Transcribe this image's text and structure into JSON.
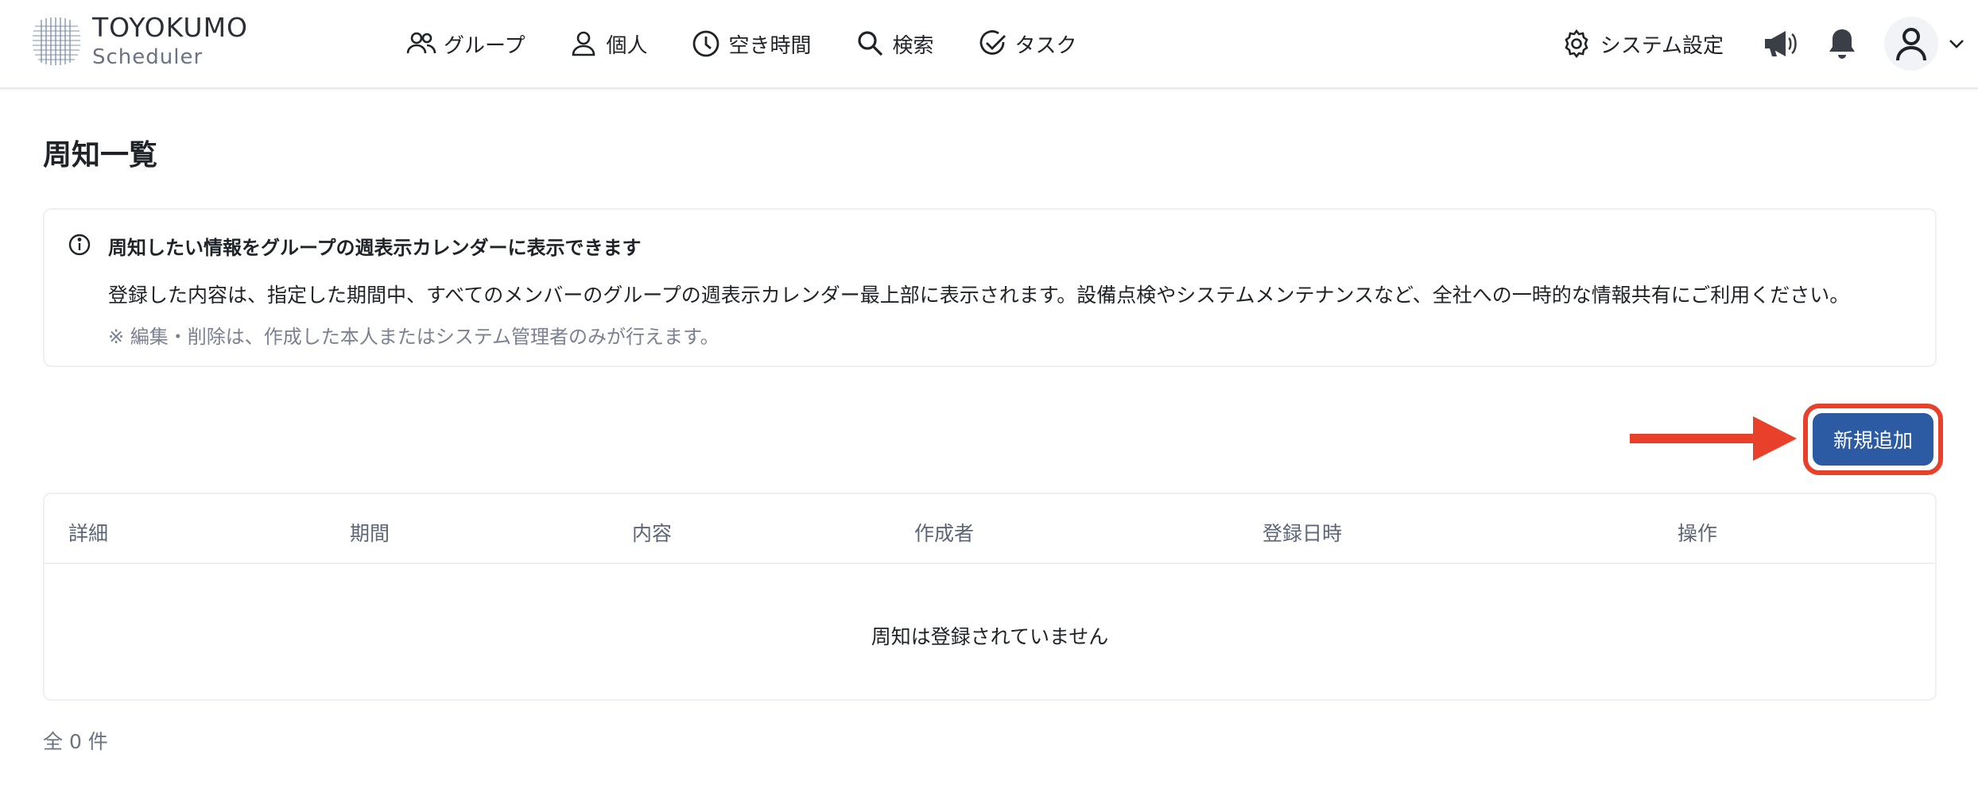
{
  "header": {
    "logo_title": "TOYOKUMO",
    "logo_sub": "Scheduler",
    "nav": [
      {
        "label": "グループ",
        "icon": "users-icon"
      },
      {
        "label": "個人",
        "icon": "user-icon"
      },
      {
        "label": "空き時間",
        "icon": "clock-icon"
      },
      {
        "label": "検索",
        "icon": "search-icon"
      },
      {
        "label": "タスク",
        "icon": "check-circle-icon"
      }
    ],
    "settings_label": "システム設定",
    "icons": [
      "gear-icon",
      "megaphone-icon",
      "bell-icon",
      "avatar-icon",
      "chevron-down-icon"
    ]
  },
  "page": {
    "title": "周知一覧"
  },
  "info": {
    "title": "周知したい情報をグループの週表示カレンダーに表示できます",
    "description": "登録した内容は、指定した期間中、すべてのメンバーのグループの週表示カレンダー最上部に表示されます。設備点検やシステムメンテナンスなど、全社への一時的な情報共有にご利用ください。",
    "note": "※ 編集・削除は、作成した本人またはシステム管理者のみが行えます。"
  },
  "actions": {
    "add_label": "新規追加"
  },
  "table": {
    "columns": [
      "詳細",
      "期間",
      "内容",
      "作成者",
      "登録日時",
      "操作"
    ],
    "empty_message": "周知は登録されていません"
  },
  "footer": {
    "total": "全 0 件"
  },
  "colors": {
    "primary_button": "#2c5aa3",
    "highlight": "#e8402b",
    "muted_text": "#6b7280"
  }
}
